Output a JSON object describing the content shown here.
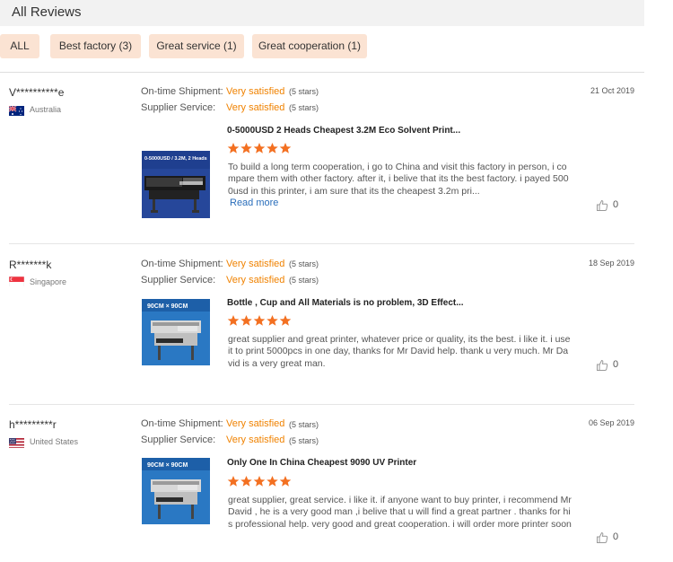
{
  "header": {
    "title": "All Reviews"
  },
  "filters": [
    {
      "label": "ALL"
    },
    {
      "label": "Best factory (3)"
    },
    {
      "label": "Great service (1)"
    },
    {
      "label": "Great cooperation (1)"
    }
  ],
  "colors": {
    "accent": "#f08200",
    "chip_bg": "#fbe3d3",
    "link": "#2a6ebb",
    "star": "#f37021"
  },
  "reviews": [
    {
      "user": "V**********e",
      "country": "Australia",
      "flag": "australia-flag-icon",
      "shipment_label": "On-time Shipment:",
      "shipment_value": "Very satisfied",
      "shipment_stars": "(5 stars)",
      "service_label": "Supplier Service:",
      "service_value": "Very satisfied",
      "service_stars": "(5 stars)",
      "date": "21 Oct 2019",
      "thumb_text": "0-5000USD / 3.2M, 2 Heads",
      "product_title": "0-5000USD 2 Heads Cheapest 3.2M Eco Solvent Print...",
      "rating": 5,
      "text": "To build a long term cooperation, i go to China and visit this factory in person, i compare them with other factory. after it, i belive that its the best factory. i payed 5000usd in this printer, i am sure that its the cheapest 3.2m pri...",
      "read_more": "Read more",
      "likes": "0"
    },
    {
      "user": "R*******k",
      "country": "Singapore",
      "flag": "singapore-flag-icon",
      "shipment_label": "On-time Shipment:",
      "shipment_value": "Very satisfied",
      "shipment_stars": "(5 stars)",
      "service_label": "Supplier Service:",
      "service_value": "Very satisfied",
      "service_stars": "(5 stars)",
      "date": "18 Sep 2019",
      "thumb_text": "90CM × 90CM",
      "product_title": "Bottle , Cup and All Materials is no problem, 3D Effect...",
      "rating": 5,
      "text": "great supplier and great printer, whatever price or quality, its the best. i like it. i use it to print 5000pcs in one day, thanks for Mr David help. thank u very much. Mr David is a very great man.",
      "likes": "0"
    },
    {
      "user": "h*********r",
      "country": "United States",
      "flag": "united-states-flag-icon",
      "shipment_label": "On-time Shipment:",
      "shipment_value": "Very satisfied",
      "shipment_stars": "(5 stars)",
      "service_label": "Supplier Service:",
      "service_value": "Very satisfied",
      "service_stars": "(5 stars)",
      "date": "06 Sep 2019",
      "thumb_text": "90CM × 90CM",
      "product_title": "Only One In China Cheapest 9090 UV Printer",
      "rating": 5,
      "text": "great supplier, great service. i like it. if anyone want to buy printer, i recommend Mr David , he is a very good man ,i belive that u will find a great partner . thanks for his professional help. very good and great cooperation. i will order more printer soon",
      "likes": "0"
    }
  ]
}
